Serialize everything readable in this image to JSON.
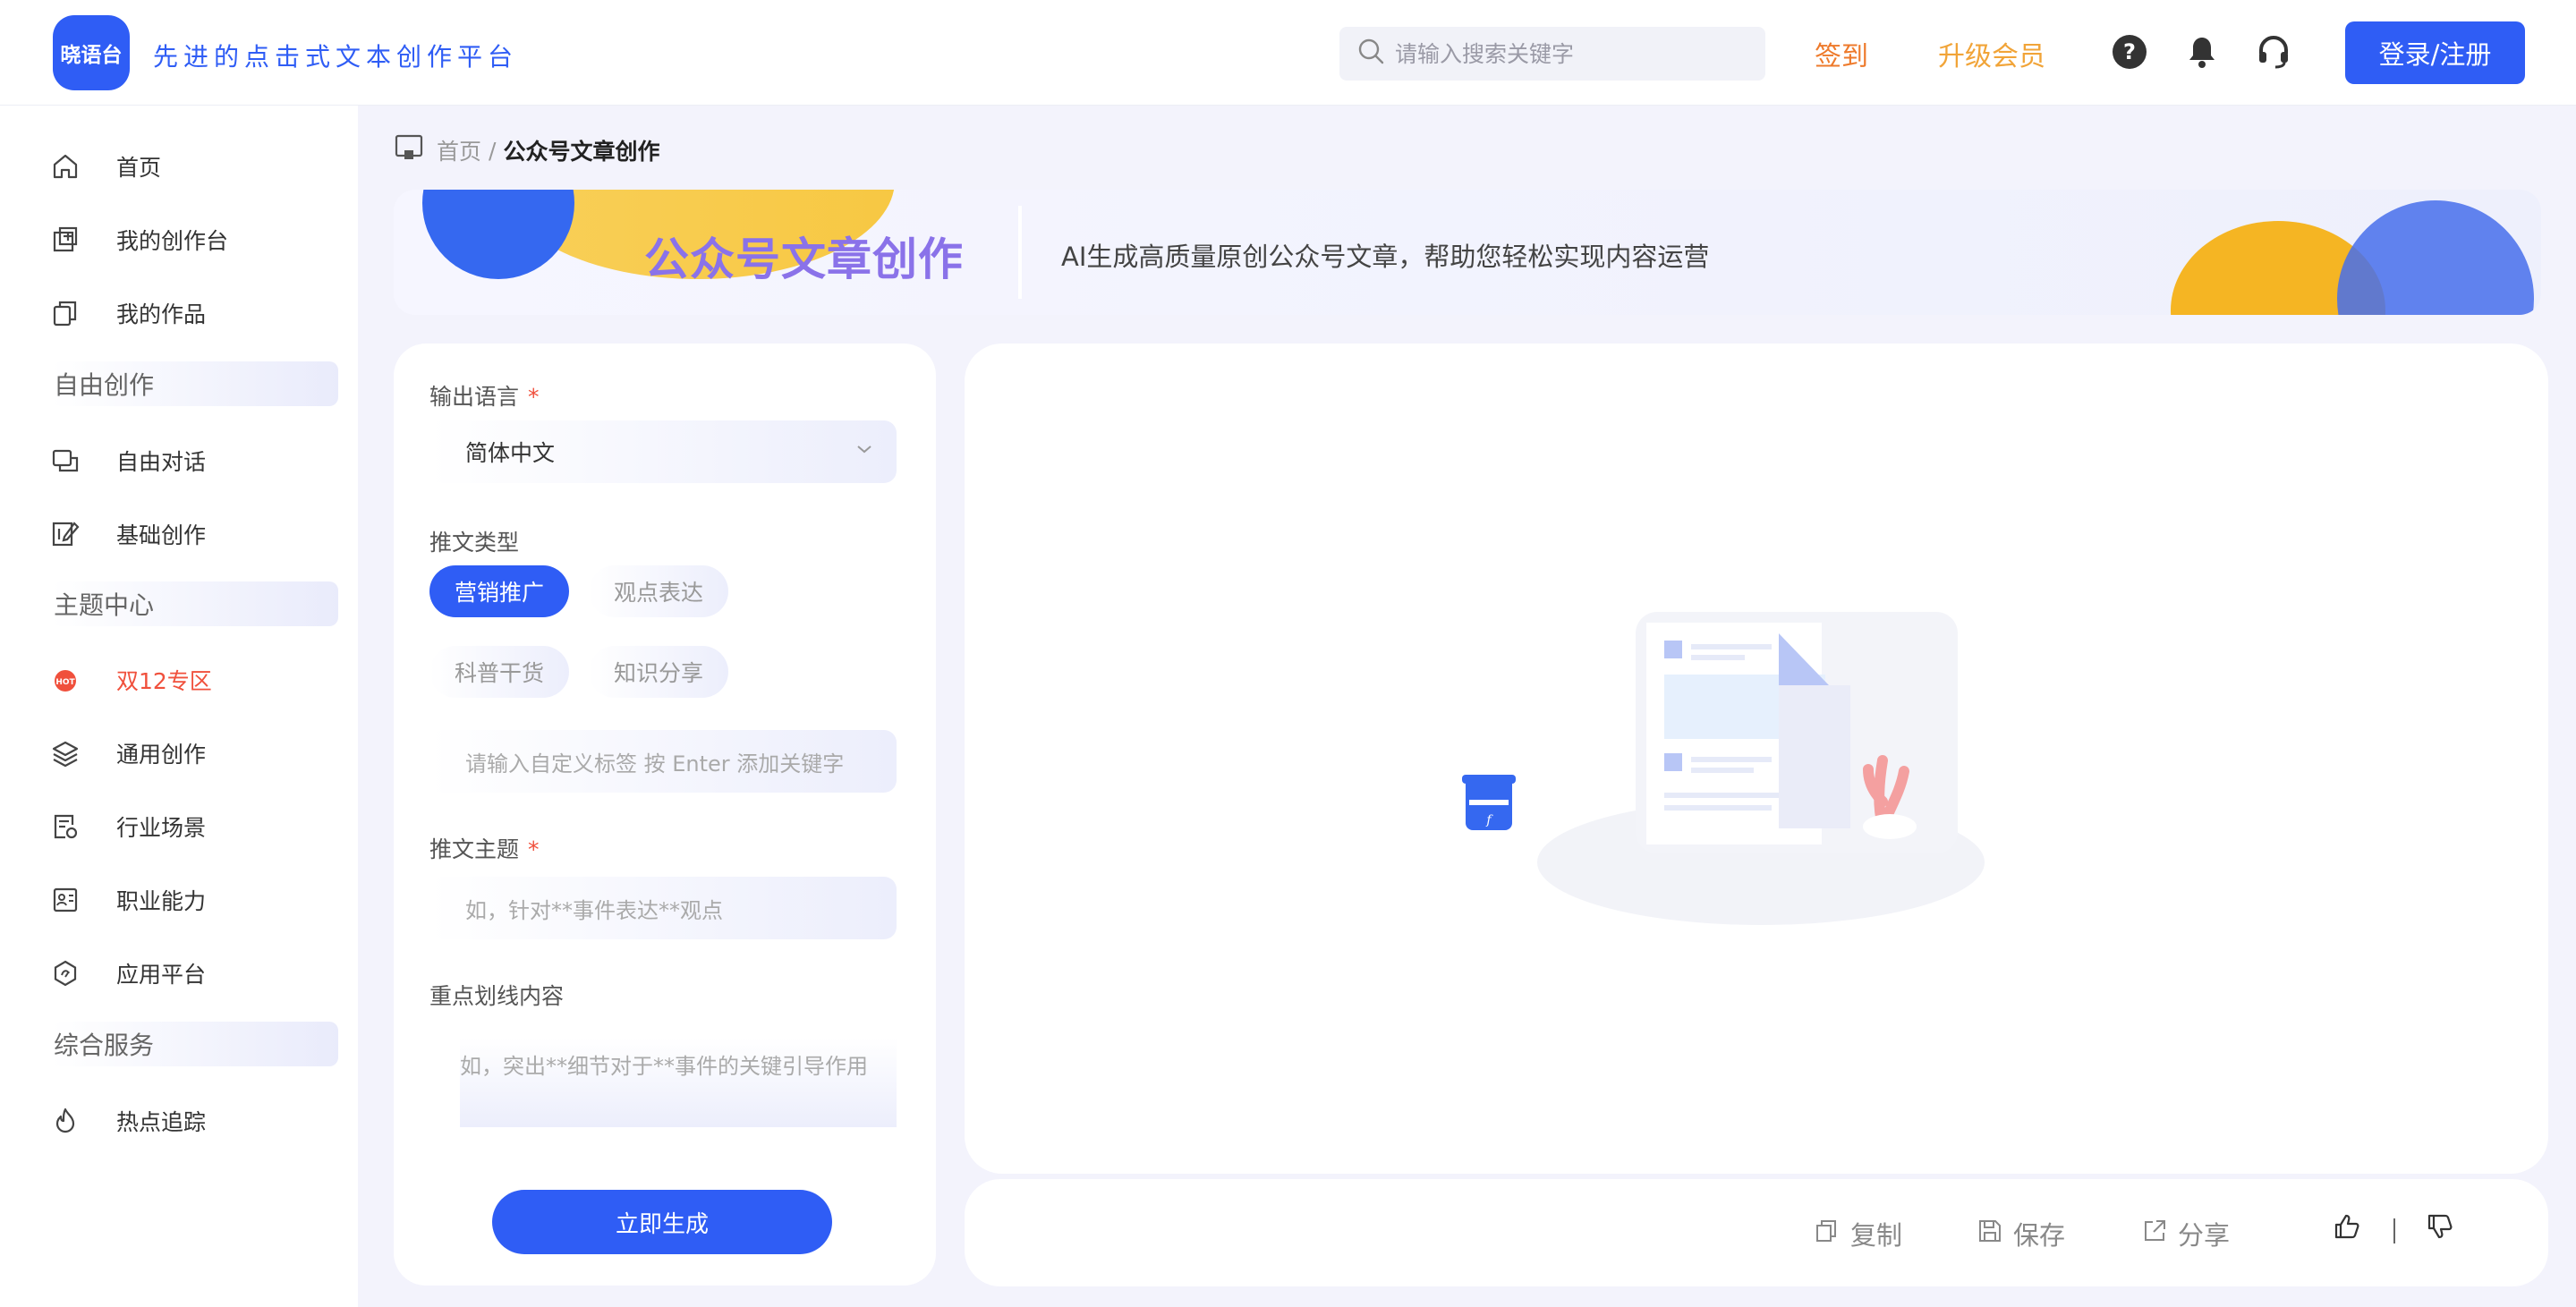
{
  "app": {
    "logo_text": "晓语台",
    "slogan": "先进的点击式文本创作平台"
  },
  "header": {
    "search_placeholder": "请输入搜索关键字",
    "signin_label": "签到",
    "vip_label": "升级会员",
    "login_label": "登录/注册"
  },
  "sidebar": {
    "items": [
      {
        "label": "首页"
      },
      {
        "label": "我的创作台"
      },
      {
        "label": "我的作品"
      }
    ],
    "section_free": "自由创作",
    "free_items": [
      {
        "label": "自由对话"
      },
      {
        "label": "基础创作"
      }
    ],
    "section_topic": "主题中心",
    "topic_items": [
      {
        "label": "双12专区"
      },
      {
        "label": "通用创作"
      },
      {
        "label": "行业场景"
      },
      {
        "label": "职业能力"
      },
      {
        "label": "应用平台"
      }
    ],
    "section_service": "综合服务",
    "service_items": [
      {
        "label": "热点追踪"
      }
    ]
  },
  "breadcrumb": {
    "home": "首页",
    "separator": "/",
    "current": "公众号文章创作"
  },
  "banner": {
    "title": "公众号文章创作",
    "description": "AI生成高质量原创公众号文章，帮助您轻松实现内容运营"
  },
  "form": {
    "language_label": "输出语言",
    "language_value": "简体中文",
    "type_label": "推文类型",
    "types": [
      "营销推广",
      "观点表达",
      "科普干货",
      "知识分享"
    ],
    "selected_type": "营销推广",
    "tag_placeholder": "请输入自定义标签 按 Enter 添加关键字",
    "topic_label": "推文主题",
    "topic_placeholder": "如，针对**事件表达**观点",
    "highlight_label": "重点划线内容",
    "highlight_placeholder": "如，突出**细节对于**事件的关键引导作用",
    "generate_label": "立即生成",
    "required_mark": "*"
  },
  "output_actions": {
    "copy": "复制",
    "save": "保存",
    "share": "分享"
  },
  "colors": {
    "primary": "#2f5df5",
    "signin": "#ee7a2b",
    "vip": "#f1a438",
    "hot": "#f0503c",
    "title_purple": "#8a72e9"
  }
}
